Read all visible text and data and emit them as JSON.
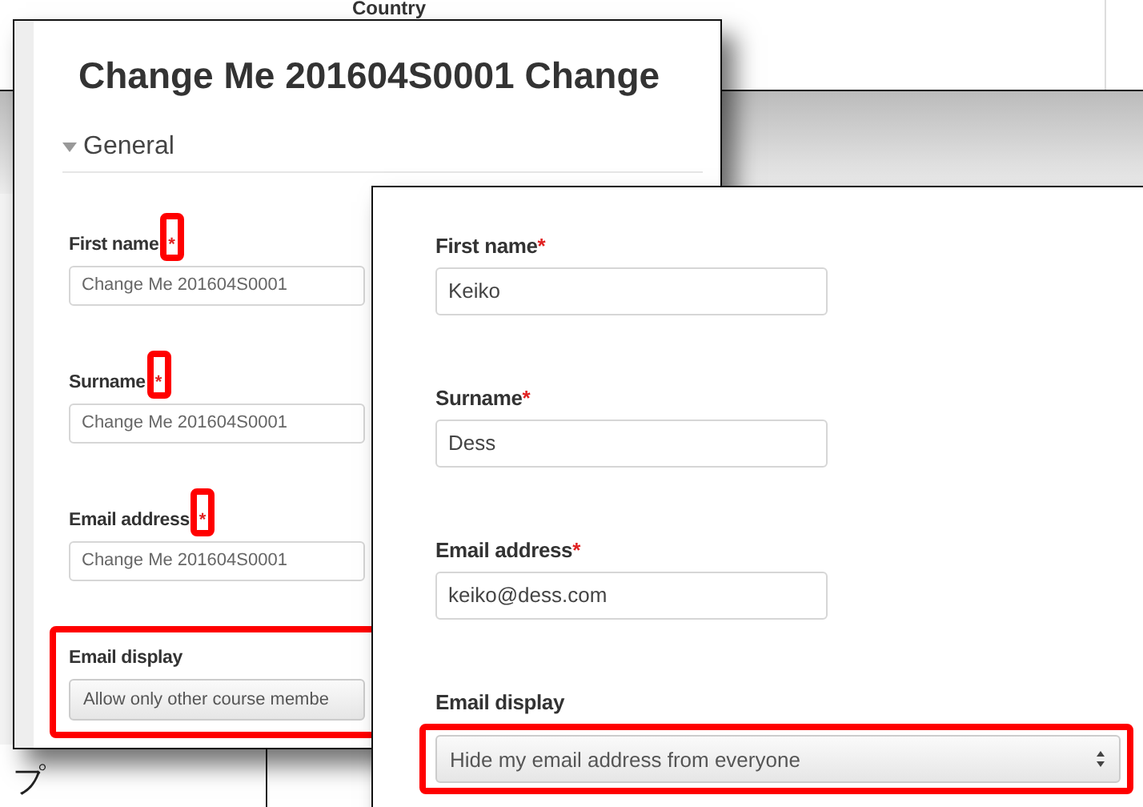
{
  "background": {
    "label": "Country",
    "footer_text": "プ"
  },
  "windows": [
    {
      "kind": "old",
      "title": "Change Me 201604S0001 Change",
      "section": {
        "label": "General",
        "expanded": true
      },
      "fields": [
        {
          "kind": "text",
          "label": "First name",
          "required_mark": "*",
          "value": "Change Me 201604S0001",
          "highlighted": true
        },
        {
          "kind": "text",
          "label": "Surname",
          "required_mark": "*",
          "value": "Change Me 201604S0001",
          "highlighted": true
        },
        {
          "kind": "text",
          "label": "Email address",
          "required_mark": "*",
          "value": "Change Me 201604S0001",
          "highlighted": true
        },
        {
          "kind": "select",
          "label": "Email display",
          "value": "Allow only other course membe",
          "highlighted": true
        }
      ]
    },
    {
      "kind": "new",
      "fields": [
        {
          "kind": "text",
          "label": "First name",
          "required_mark": "*",
          "value": "Keiko",
          "highlighted": false
        },
        {
          "kind": "text",
          "label": "Surname",
          "required_mark": "*",
          "value": "Dess",
          "highlighted": false
        },
        {
          "kind": "text",
          "label": "Email address",
          "required_mark": "*",
          "value": "keiko@dess.com",
          "highlighted": false
        },
        {
          "kind": "select",
          "label": "Email display",
          "value": "Hide my email address from everyone",
          "highlighted": true
        }
      ]
    }
  ]
}
